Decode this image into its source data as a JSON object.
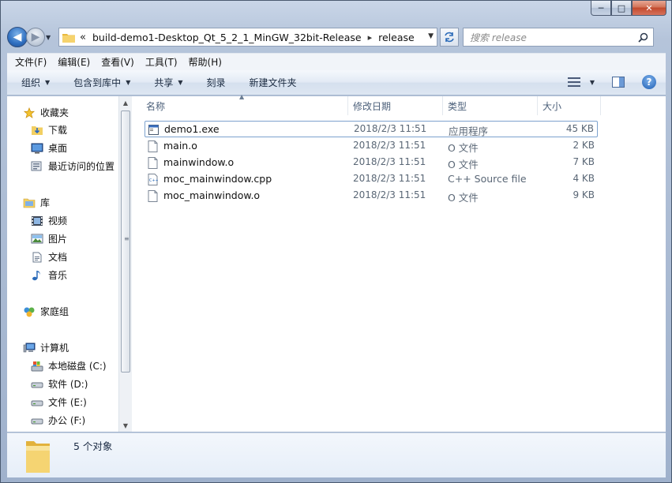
{
  "window": {
    "caption": {
      "minimize": "─",
      "maximize": "□",
      "close": "✕"
    }
  },
  "nav": {
    "back_glyph": "◀",
    "forward_glyph": "▶"
  },
  "address": {
    "overflow": "«",
    "crumbs": [
      "build-demo1-Desktop_Qt_5_2_1_MinGW_32bit-Release",
      "release"
    ],
    "separator": "▸"
  },
  "search": {
    "placeholder": "搜索 release"
  },
  "menubar": {
    "items": [
      "文件(F)",
      "编辑(E)",
      "查看(V)",
      "工具(T)",
      "帮助(H)"
    ]
  },
  "commandbar": {
    "items": [
      {
        "label": "组织",
        "dropdown": true
      },
      {
        "label": "包含到库中",
        "dropdown": true
      },
      {
        "label": "共享",
        "dropdown": true
      },
      {
        "label": "刻录",
        "dropdown": false
      },
      {
        "label": "新建文件夹",
        "dropdown": false
      }
    ]
  },
  "navpane": {
    "favorites": {
      "label": "收藏夹",
      "items": [
        "下载",
        "桌面",
        "最近访问的位置"
      ]
    },
    "libraries": {
      "label": "库",
      "items": [
        "视频",
        "图片",
        "文档",
        "音乐"
      ]
    },
    "homegroup": {
      "label": "家庭组"
    },
    "computer": {
      "label": "计算机",
      "items": [
        "本地磁盘 (C:)",
        "软件 (D:)",
        "文件 (E:)",
        "办公 (F:)"
      ]
    }
  },
  "filelist": {
    "columns": [
      "名称",
      "修改日期",
      "类型",
      "大小"
    ],
    "rows": [
      {
        "name": "demo1.exe",
        "date": "2018/2/3 11:51",
        "type": "应用程序",
        "size": "45 KB",
        "icon": "exe-icon"
      },
      {
        "name": "main.o",
        "date": "2018/2/3 11:51",
        "type": "O 文件",
        "size": "2 KB",
        "icon": "file-icon"
      },
      {
        "name": "mainwindow.o",
        "date": "2018/2/3 11:51",
        "type": "O 文件",
        "size": "7 KB",
        "icon": "file-icon"
      },
      {
        "name": "moc_mainwindow.cpp",
        "date": "2018/2/3 11:51",
        "type": "C++ Source file",
        "size": "4 KB",
        "icon": "cpp-file-icon"
      },
      {
        "name": "moc_mainwindow.o",
        "date": "2018/2/3 11:51",
        "type": "O 文件",
        "size": "9 KB",
        "icon": "file-icon"
      }
    ]
  },
  "details": {
    "summary": "5 个对象"
  },
  "colors": {
    "accent": "#2f6fc0",
    "selection_border": "#7da2ce",
    "folder": "#f2cf62"
  }
}
